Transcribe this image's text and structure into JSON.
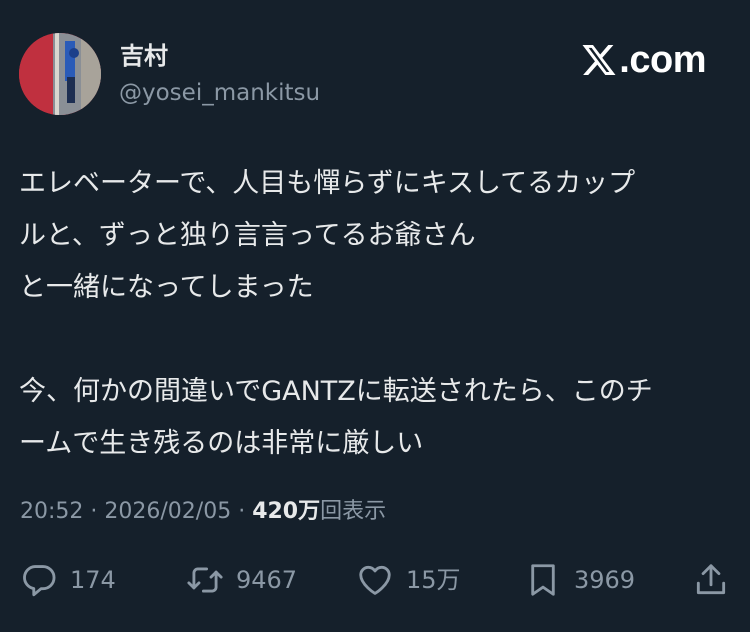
{
  "author": {
    "name": "吉村",
    "handle": "@yosei_mankitsu"
  },
  "brand": {
    "logo_text": ".com",
    "icon": "x-logo-icon"
  },
  "tweet": {
    "lines": [
      "エレベーターで、人目も憚らずにキスしてるカップ",
      "ルと、ずっと独り言言ってるお爺さん",
      "と一緒になってしまった",
      "今、何かの間違いでGANTZに転送されたら、このチ",
      "ームで生き残るのは非常に厳しい"
    ]
  },
  "meta": {
    "time": "20:52",
    "separator": " · ",
    "date": "2026/02/05",
    "views_value": "420万",
    "views_label": "回表示"
  },
  "actions": {
    "reply": {
      "icon": "reply-icon",
      "count": "174"
    },
    "retweet": {
      "icon": "retweet-icon",
      "count": "9467"
    },
    "like": {
      "icon": "heart-icon",
      "count": "15万"
    },
    "bookmark": {
      "icon": "bookmark-icon",
      "count": "3969"
    },
    "share": {
      "icon": "share-icon"
    }
  },
  "colors": {
    "background": "#15202b",
    "text": "#e7e9ea",
    "secondary": "#8b98a5",
    "avatar_red": "#c0303f"
  }
}
